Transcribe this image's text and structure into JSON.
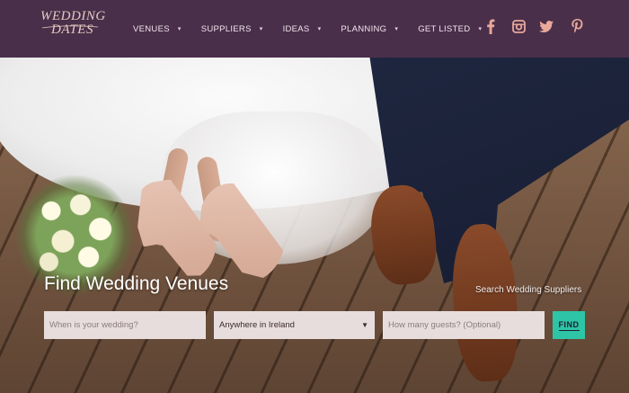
{
  "brand": {
    "logo_line1": "WEDDING",
    "logo_line2": "DATES"
  },
  "nav": {
    "items": [
      {
        "label": "VENUES"
      },
      {
        "label": "SUPPLIERS"
      },
      {
        "label": "IDEAS"
      },
      {
        "label": "PLANNING"
      },
      {
        "label": "GET LISTED"
      }
    ],
    "caret": "▾"
  },
  "social": {
    "icons": [
      "facebook-icon",
      "instagram-icon",
      "twitter-icon",
      "pinterest-icon"
    ],
    "color": "#e8a89a"
  },
  "hero": {
    "title": "Find Wedding Venues",
    "supplier_link": "Search Wedding Suppliers"
  },
  "search": {
    "date_placeholder": "When is your wedding?",
    "location_value": "Anywhere in Ireland",
    "location_arrow": "▼",
    "guests_placeholder": "How many guests? (Optional)",
    "find_label": "FIND"
  },
  "colors": {
    "header_bg": "#4a2f4a",
    "accent": "#2ec4a6",
    "field_bg": "#e8dddd"
  }
}
